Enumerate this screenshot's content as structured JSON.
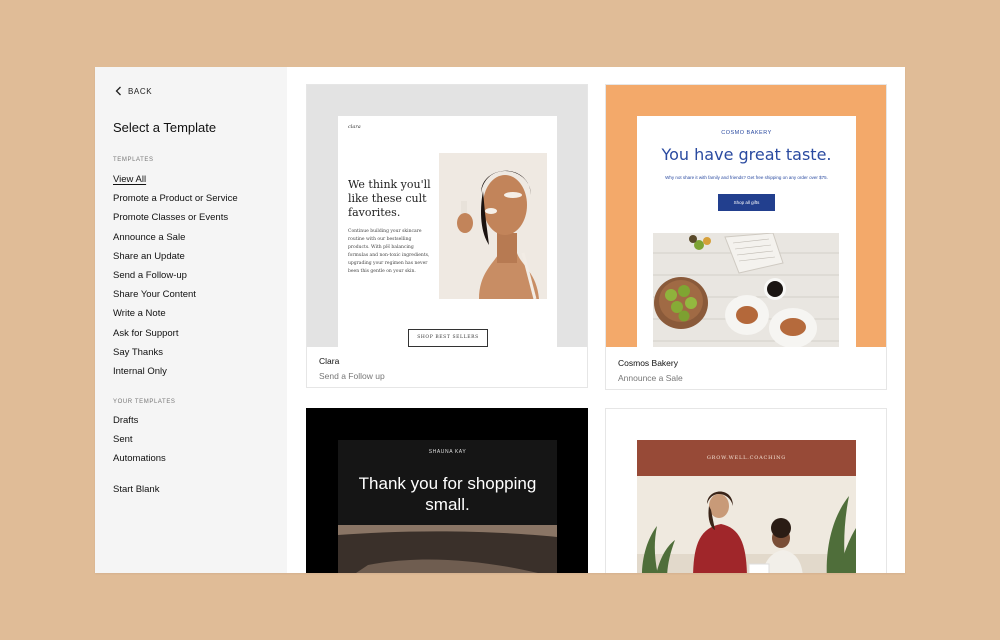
{
  "sidebar": {
    "back_label": "BACK",
    "title": "Select a Template",
    "templates_label": "TEMPLATES",
    "templates": [
      {
        "label": "View All",
        "active": true
      },
      {
        "label": "Promote a Product or Service"
      },
      {
        "label": "Promote Classes or Events"
      },
      {
        "label": "Announce a Sale"
      },
      {
        "label": "Share an Update"
      },
      {
        "label": "Send a Follow-up"
      },
      {
        "label": "Share Your Content"
      },
      {
        "label": "Write a Note"
      },
      {
        "label": "Ask for Support"
      },
      {
        "label": "Say Thanks"
      },
      {
        "label": "Internal Only"
      }
    ],
    "your_templates_label": "YOUR TEMPLATES",
    "your_templates": [
      {
        "label": "Drafts"
      },
      {
        "label": "Sent"
      },
      {
        "label": "Automations"
      }
    ],
    "start_blank": "Start Blank"
  },
  "cards": [
    {
      "name": "Clara",
      "subtitle": "Send a Follow up",
      "preview": {
        "logo": "clara",
        "headline": "We think you'll like these cult favorites.",
        "body": "Continue building your skincare routine with our bestselling products. With pH balancing formulas and non-toxic ingredients, upgrading your regimen has never been this gentle on your skin.",
        "button": "SHOP BEST SELLERS"
      }
    },
    {
      "name": "Cosmos Bakery",
      "subtitle": "Announce a Sale",
      "preview": {
        "logo": "COSMO BAKERY",
        "headline": "You have great taste.",
        "body": "Why not share it with family and friends? Get free shipping on any order over $75.",
        "button": "Shop all gifts"
      }
    },
    {
      "preview": {
        "logo": "SHAUNA KAY",
        "headline": "Thank you for shopping small."
      }
    },
    {
      "preview": {
        "logo": "GROW.WELL.COACHING"
      }
    }
  ],
  "colors": {
    "page_background": "#e0bc97",
    "cosmo_orange": "#f3a96a",
    "cosmo_blue": "#2a4aa0",
    "grow_rust": "#974a37"
  }
}
